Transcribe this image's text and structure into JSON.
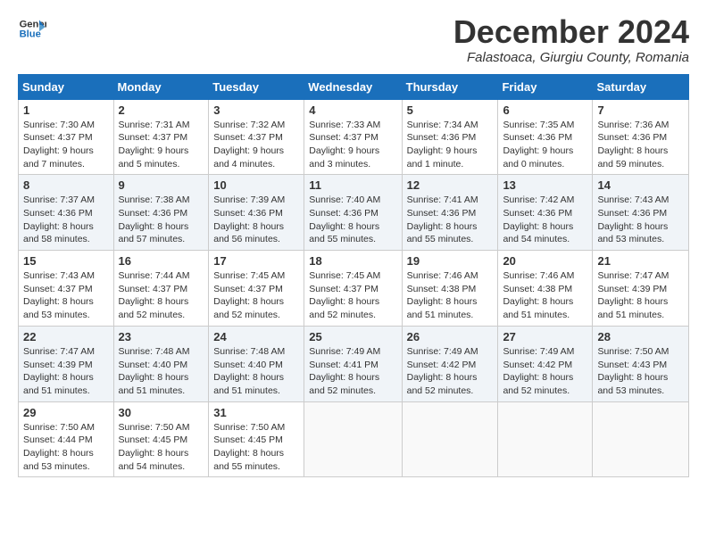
{
  "header": {
    "logo_general": "General",
    "logo_blue": "Blue",
    "title": "December 2024",
    "location": "Falastoaca, Giurgiu County, Romania"
  },
  "weekdays": [
    "Sunday",
    "Monday",
    "Tuesday",
    "Wednesday",
    "Thursday",
    "Friday",
    "Saturday"
  ],
  "weeks": [
    [
      {
        "day": "1",
        "sunrise": "Sunrise: 7:30 AM",
        "sunset": "Sunset: 4:37 PM",
        "daylight": "Daylight: 9 hours and 7 minutes."
      },
      {
        "day": "2",
        "sunrise": "Sunrise: 7:31 AM",
        "sunset": "Sunset: 4:37 PM",
        "daylight": "Daylight: 9 hours and 5 minutes."
      },
      {
        "day": "3",
        "sunrise": "Sunrise: 7:32 AM",
        "sunset": "Sunset: 4:37 PM",
        "daylight": "Daylight: 9 hours and 4 minutes."
      },
      {
        "day": "4",
        "sunrise": "Sunrise: 7:33 AM",
        "sunset": "Sunset: 4:37 PM",
        "daylight": "Daylight: 9 hours and 3 minutes."
      },
      {
        "day": "5",
        "sunrise": "Sunrise: 7:34 AM",
        "sunset": "Sunset: 4:36 PM",
        "daylight": "Daylight: 9 hours and 1 minute."
      },
      {
        "day": "6",
        "sunrise": "Sunrise: 7:35 AM",
        "sunset": "Sunset: 4:36 PM",
        "daylight": "Daylight: 9 hours and 0 minutes."
      },
      {
        "day": "7",
        "sunrise": "Sunrise: 7:36 AM",
        "sunset": "Sunset: 4:36 PM",
        "daylight": "Daylight: 8 hours and 59 minutes."
      }
    ],
    [
      {
        "day": "8",
        "sunrise": "Sunrise: 7:37 AM",
        "sunset": "Sunset: 4:36 PM",
        "daylight": "Daylight: 8 hours and 58 minutes."
      },
      {
        "day": "9",
        "sunrise": "Sunrise: 7:38 AM",
        "sunset": "Sunset: 4:36 PM",
        "daylight": "Daylight: 8 hours and 57 minutes."
      },
      {
        "day": "10",
        "sunrise": "Sunrise: 7:39 AM",
        "sunset": "Sunset: 4:36 PM",
        "daylight": "Daylight: 8 hours and 56 minutes."
      },
      {
        "day": "11",
        "sunrise": "Sunrise: 7:40 AM",
        "sunset": "Sunset: 4:36 PM",
        "daylight": "Daylight: 8 hours and 55 minutes."
      },
      {
        "day": "12",
        "sunrise": "Sunrise: 7:41 AM",
        "sunset": "Sunset: 4:36 PM",
        "daylight": "Daylight: 8 hours and 55 minutes."
      },
      {
        "day": "13",
        "sunrise": "Sunrise: 7:42 AM",
        "sunset": "Sunset: 4:36 PM",
        "daylight": "Daylight: 8 hours and 54 minutes."
      },
      {
        "day": "14",
        "sunrise": "Sunrise: 7:43 AM",
        "sunset": "Sunset: 4:36 PM",
        "daylight": "Daylight: 8 hours and 53 minutes."
      }
    ],
    [
      {
        "day": "15",
        "sunrise": "Sunrise: 7:43 AM",
        "sunset": "Sunset: 4:37 PM",
        "daylight": "Daylight: 8 hours and 53 minutes."
      },
      {
        "day": "16",
        "sunrise": "Sunrise: 7:44 AM",
        "sunset": "Sunset: 4:37 PM",
        "daylight": "Daylight: 8 hours and 52 minutes."
      },
      {
        "day": "17",
        "sunrise": "Sunrise: 7:45 AM",
        "sunset": "Sunset: 4:37 PM",
        "daylight": "Daylight: 8 hours and 52 minutes."
      },
      {
        "day": "18",
        "sunrise": "Sunrise: 7:45 AM",
        "sunset": "Sunset: 4:37 PM",
        "daylight": "Daylight: 8 hours and 52 minutes."
      },
      {
        "day": "19",
        "sunrise": "Sunrise: 7:46 AM",
        "sunset": "Sunset: 4:38 PM",
        "daylight": "Daylight: 8 hours and 51 minutes."
      },
      {
        "day": "20",
        "sunrise": "Sunrise: 7:46 AM",
        "sunset": "Sunset: 4:38 PM",
        "daylight": "Daylight: 8 hours and 51 minutes."
      },
      {
        "day": "21",
        "sunrise": "Sunrise: 7:47 AM",
        "sunset": "Sunset: 4:39 PM",
        "daylight": "Daylight: 8 hours and 51 minutes."
      }
    ],
    [
      {
        "day": "22",
        "sunrise": "Sunrise: 7:47 AM",
        "sunset": "Sunset: 4:39 PM",
        "daylight": "Daylight: 8 hours and 51 minutes."
      },
      {
        "day": "23",
        "sunrise": "Sunrise: 7:48 AM",
        "sunset": "Sunset: 4:40 PM",
        "daylight": "Daylight: 8 hours and 51 minutes."
      },
      {
        "day": "24",
        "sunrise": "Sunrise: 7:48 AM",
        "sunset": "Sunset: 4:40 PM",
        "daylight": "Daylight: 8 hours and 51 minutes."
      },
      {
        "day": "25",
        "sunrise": "Sunrise: 7:49 AM",
        "sunset": "Sunset: 4:41 PM",
        "daylight": "Daylight: 8 hours and 52 minutes."
      },
      {
        "day": "26",
        "sunrise": "Sunrise: 7:49 AM",
        "sunset": "Sunset: 4:42 PM",
        "daylight": "Daylight: 8 hours and 52 minutes."
      },
      {
        "day": "27",
        "sunrise": "Sunrise: 7:49 AM",
        "sunset": "Sunset: 4:42 PM",
        "daylight": "Daylight: 8 hours and 52 minutes."
      },
      {
        "day": "28",
        "sunrise": "Sunrise: 7:50 AM",
        "sunset": "Sunset: 4:43 PM",
        "daylight": "Daylight: 8 hours and 53 minutes."
      }
    ],
    [
      {
        "day": "29",
        "sunrise": "Sunrise: 7:50 AM",
        "sunset": "Sunset: 4:44 PM",
        "daylight": "Daylight: 8 hours and 53 minutes."
      },
      {
        "day": "30",
        "sunrise": "Sunrise: 7:50 AM",
        "sunset": "Sunset: 4:45 PM",
        "daylight": "Daylight: 8 hours and 54 minutes."
      },
      {
        "day": "31",
        "sunrise": "Sunrise: 7:50 AM",
        "sunset": "Sunset: 4:45 PM",
        "daylight": "Daylight: 8 hours and 55 minutes."
      },
      null,
      null,
      null,
      null
    ]
  ]
}
